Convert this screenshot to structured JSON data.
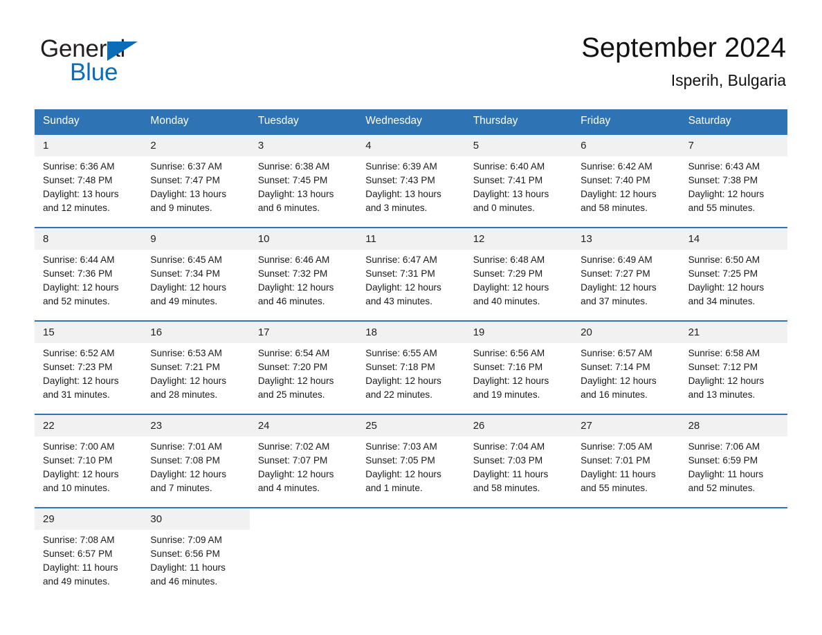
{
  "brand": {
    "logo_line1": "General",
    "logo_line2": "Blue",
    "accent_color": "#0b6cb7"
  },
  "header": {
    "title": "September 2024",
    "subtitle": "Isperih, Bulgaria"
  },
  "colors": {
    "header_blue": "#2e74b5",
    "day_band_gray": "#f1f1f1",
    "text": "#1a1a1a"
  },
  "calendar": {
    "weekday_headers": [
      "Sunday",
      "Monday",
      "Tuesday",
      "Wednesday",
      "Thursday",
      "Friday",
      "Saturday"
    ],
    "weeks": [
      {
        "days": [
          {
            "num": "1",
            "sunrise": "Sunrise: 6:36 AM",
            "sunset": "Sunset: 7:48 PM",
            "daylight": "Daylight: 13 hours and 12 minutes."
          },
          {
            "num": "2",
            "sunrise": "Sunrise: 6:37 AM",
            "sunset": "Sunset: 7:47 PM",
            "daylight": "Daylight: 13 hours and 9 minutes."
          },
          {
            "num": "3",
            "sunrise": "Sunrise: 6:38 AM",
            "sunset": "Sunset: 7:45 PM",
            "daylight": "Daylight: 13 hours and 6 minutes."
          },
          {
            "num": "4",
            "sunrise": "Sunrise: 6:39 AM",
            "sunset": "Sunset: 7:43 PM",
            "daylight": "Daylight: 13 hours and 3 minutes."
          },
          {
            "num": "5",
            "sunrise": "Sunrise: 6:40 AM",
            "sunset": "Sunset: 7:41 PM",
            "daylight": "Daylight: 13 hours and 0 minutes."
          },
          {
            "num": "6",
            "sunrise": "Sunrise: 6:42 AM",
            "sunset": "Sunset: 7:40 PM",
            "daylight": "Daylight: 12 hours and 58 minutes."
          },
          {
            "num": "7",
            "sunrise": "Sunrise: 6:43 AM",
            "sunset": "Sunset: 7:38 PM",
            "daylight": "Daylight: 12 hours and 55 minutes."
          }
        ]
      },
      {
        "days": [
          {
            "num": "8",
            "sunrise": "Sunrise: 6:44 AM",
            "sunset": "Sunset: 7:36 PM",
            "daylight": "Daylight: 12 hours and 52 minutes."
          },
          {
            "num": "9",
            "sunrise": "Sunrise: 6:45 AM",
            "sunset": "Sunset: 7:34 PM",
            "daylight": "Daylight: 12 hours and 49 minutes."
          },
          {
            "num": "10",
            "sunrise": "Sunrise: 6:46 AM",
            "sunset": "Sunset: 7:32 PM",
            "daylight": "Daylight: 12 hours and 46 minutes."
          },
          {
            "num": "11",
            "sunrise": "Sunrise: 6:47 AM",
            "sunset": "Sunset: 7:31 PM",
            "daylight": "Daylight: 12 hours and 43 minutes."
          },
          {
            "num": "12",
            "sunrise": "Sunrise: 6:48 AM",
            "sunset": "Sunset: 7:29 PM",
            "daylight": "Daylight: 12 hours and 40 minutes."
          },
          {
            "num": "13",
            "sunrise": "Sunrise: 6:49 AM",
            "sunset": "Sunset: 7:27 PM",
            "daylight": "Daylight: 12 hours and 37 minutes."
          },
          {
            "num": "14",
            "sunrise": "Sunrise: 6:50 AM",
            "sunset": "Sunset: 7:25 PM",
            "daylight": "Daylight: 12 hours and 34 minutes."
          }
        ]
      },
      {
        "days": [
          {
            "num": "15",
            "sunrise": "Sunrise: 6:52 AM",
            "sunset": "Sunset: 7:23 PM",
            "daylight": "Daylight: 12 hours and 31 minutes."
          },
          {
            "num": "16",
            "sunrise": "Sunrise: 6:53 AM",
            "sunset": "Sunset: 7:21 PM",
            "daylight": "Daylight: 12 hours and 28 minutes."
          },
          {
            "num": "17",
            "sunrise": "Sunrise: 6:54 AM",
            "sunset": "Sunset: 7:20 PM",
            "daylight": "Daylight: 12 hours and 25 minutes."
          },
          {
            "num": "18",
            "sunrise": "Sunrise: 6:55 AM",
            "sunset": "Sunset: 7:18 PM",
            "daylight": "Daylight: 12 hours and 22 minutes."
          },
          {
            "num": "19",
            "sunrise": "Sunrise: 6:56 AM",
            "sunset": "Sunset: 7:16 PM",
            "daylight": "Daylight: 12 hours and 19 minutes."
          },
          {
            "num": "20",
            "sunrise": "Sunrise: 6:57 AM",
            "sunset": "Sunset: 7:14 PM",
            "daylight": "Daylight: 12 hours and 16 minutes."
          },
          {
            "num": "21",
            "sunrise": "Sunrise: 6:58 AM",
            "sunset": "Sunset: 7:12 PM",
            "daylight": "Daylight: 12 hours and 13 minutes."
          }
        ]
      },
      {
        "days": [
          {
            "num": "22",
            "sunrise": "Sunrise: 7:00 AM",
            "sunset": "Sunset: 7:10 PM",
            "daylight": "Daylight: 12 hours and 10 minutes."
          },
          {
            "num": "23",
            "sunrise": "Sunrise: 7:01 AM",
            "sunset": "Sunset: 7:08 PM",
            "daylight": "Daylight: 12 hours and 7 minutes."
          },
          {
            "num": "24",
            "sunrise": "Sunrise: 7:02 AM",
            "sunset": "Sunset: 7:07 PM",
            "daylight": "Daylight: 12 hours and 4 minutes."
          },
          {
            "num": "25",
            "sunrise": "Sunrise: 7:03 AM",
            "sunset": "Sunset: 7:05 PM",
            "daylight": "Daylight: 12 hours and 1 minute."
          },
          {
            "num": "26",
            "sunrise": "Sunrise: 7:04 AM",
            "sunset": "Sunset: 7:03 PM",
            "daylight": "Daylight: 11 hours and 58 minutes."
          },
          {
            "num": "27",
            "sunrise": "Sunrise: 7:05 AM",
            "sunset": "Sunset: 7:01 PM",
            "daylight": "Daylight: 11 hours and 55 minutes."
          },
          {
            "num": "28",
            "sunrise": "Sunrise: 7:06 AM",
            "sunset": "Sunset: 6:59 PM",
            "daylight": "Daylight: 11 hours and 52 minutes."
          }
        ]
      },
      {
        "days": [
          {
            "num": "29",
            "sunrise": "Sunrise: 7:08 AM",
            "sunset": "Sunset: 6:57 PM",
            "daylight": "Daylight: 11 hours and 49 minutes."
          },
          {
            "num": "30",
            "sunrise": "Sunrise: 7:09 AM",
            "sunset": "Sunset: 6:56 PM",
            "daylight": "Daylight: 11 hours and 46 minutes."
          },
          {
            "num": "",
            "sunrise": "",
            "sunset": "",
            "daylight": ""
          },
          {
            "num": "",
            "sunrise": "",
            "sunset": "",
            "daylight": ""
          },
          {
            "num": "",
            "sunrise": "",
            "sunset": "",
            "daylight": ""
          },
          {
            "num": "",
            "sunrise": "",
            "sunset": "",
            "daylight": ""
          },
          {
            "num": "",
            "sunrise": "",
            "sunset": "",
            "daylight": ""
          }
        ]
      }
    ]
  }
}
